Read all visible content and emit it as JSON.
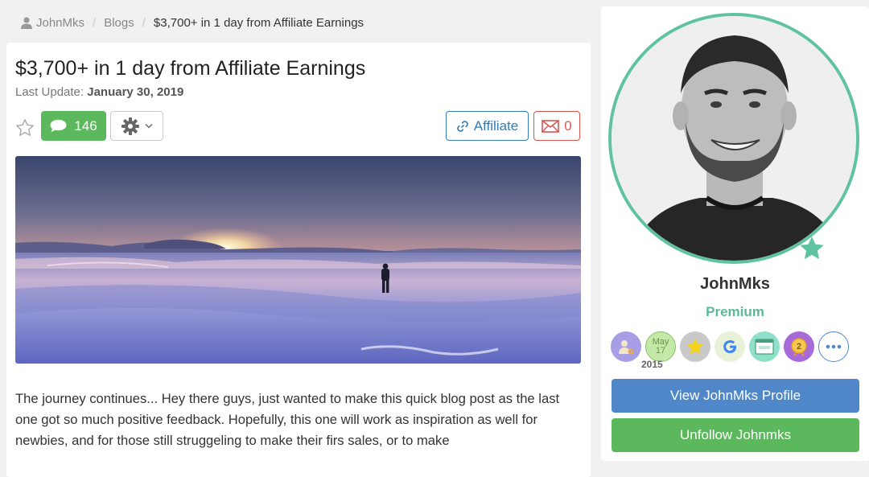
{
  "breadcrumb": {
    "user": "JohnMks",
    "section": "Blogs",
    "current": "$3,700+ in 1 day from Affiliate Earnings",
    "separator": "/"
  },
  "post": {
    "title": "$3,700+ in 1 day from Affiliate Earnings",
    "last_update_label": "Last Update:",
    "last_update_date": "January 30, 2019",
    "comment_count": "146",
    "affiliate_label": "Affiliate",
    "mail_count": "0",
    "body": "The journey continues... Hey there guys, just wanted to make this quick blog post as the last one got so much positive feedback. Hopefully, this one will work as inspiration as well for newbies, and for those still struggeling to make their firs sales, or to make"
  },
  "profile": {
    "username": "JohnMks",
    "tier": "Premium",
    "badges": [
      {
        "icon": "user-settings-icon",
        "color": "#a79ee6"
      },
      {
        "icon": "member-since-icon",
        "color": "#b8e39a",
        "month": "May",
        "day": "17",
        "year": "2015"
      },
      {
        "icon": "star-badge-icon",
        "color": "#c9c9c9"
      },
      {
        "icon": "google-icon",
        "color": "#e8f2d8"
      },
      {
        "icon": "website-icon",
        "color": "#8fe0c9"
      },
      {
        "icon": "rank-2-icon",
        "color": "#a86ad9",
        "number": "2"
      },
      {
        "icon": "more-icon",
        "color": "#ffffff"
      }
    ],
    "view_profile_label": "View JohnMks Profile",
    "unfollow_label": "Unfollow Johnmks"
  },
  "colors": {
    "green": "#5cb85c",
    "blue": "#337ab7",
    "red": "#d9534f",
    "premium": "#5fc3a0"
  }
}
